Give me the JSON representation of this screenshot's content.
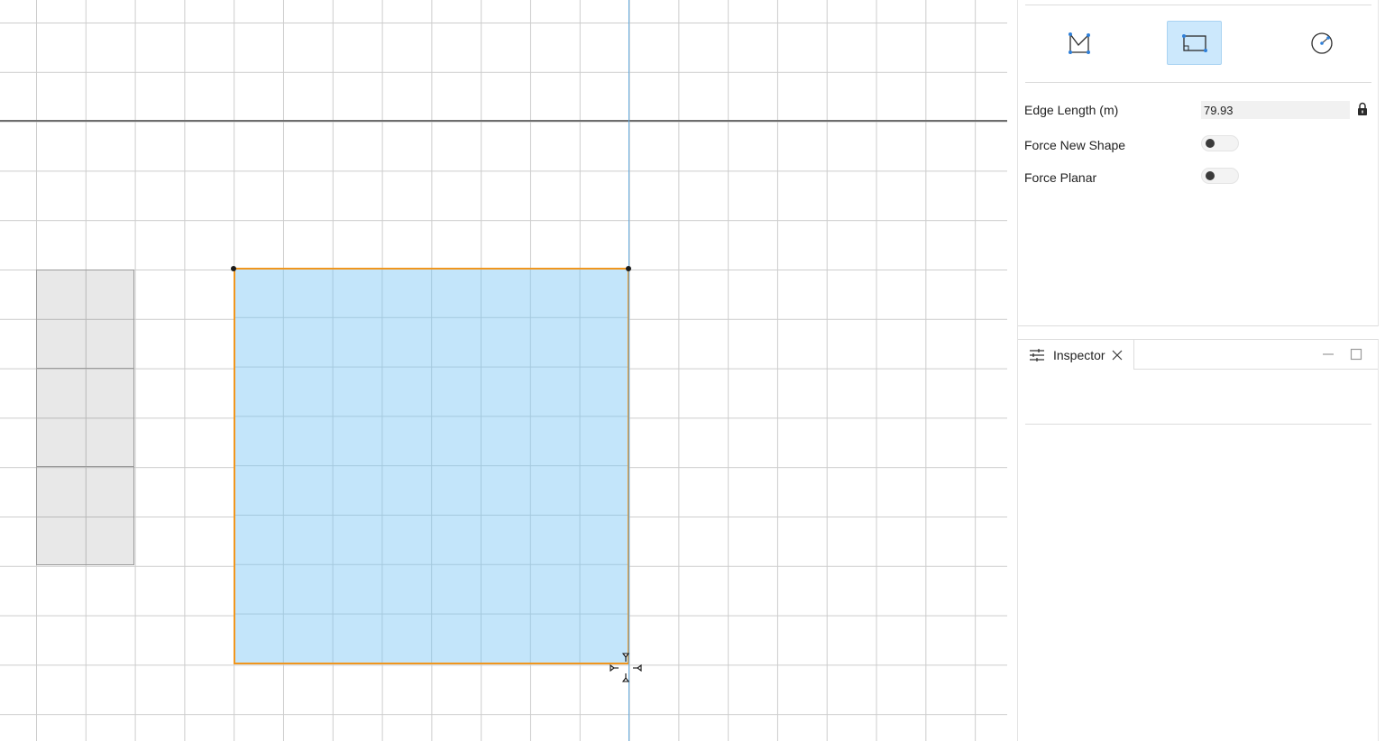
{
  "canvas": {
    "description_colors": {
      "grid": "#cdcdcd",
      "selection_fill": "#c3e5fa",
      "selection_border": "#f0961e",
      "guide_line": "#62a8dc",
      "block_fill": "#e8e8e8"
    }
  },
  "draw_tools": {
    "items": [
      {
        "icon": "polyline-icon",
        "active": false
      },
      {
        "icon": "rectangle-icon",
        "active": true
      },
      {
        "icon": "circle-icon",
        "active": false
      }
    ]
  },
  "properties": {
    "edge_length_label": "Edge Length (m)",
    "edge_length_value": "79.93",
    "edge_length_locked": true,
    "force_new_shape_label": "Force New Shape",
    "force_new_shape_on": false,
    "force_planar_label": "Force Planar",
    "force_planar_on": false
  },
  "inspector": {
    "tab_label": "Inspector"
  },
  "accent_color": "#cce8fc"
}
